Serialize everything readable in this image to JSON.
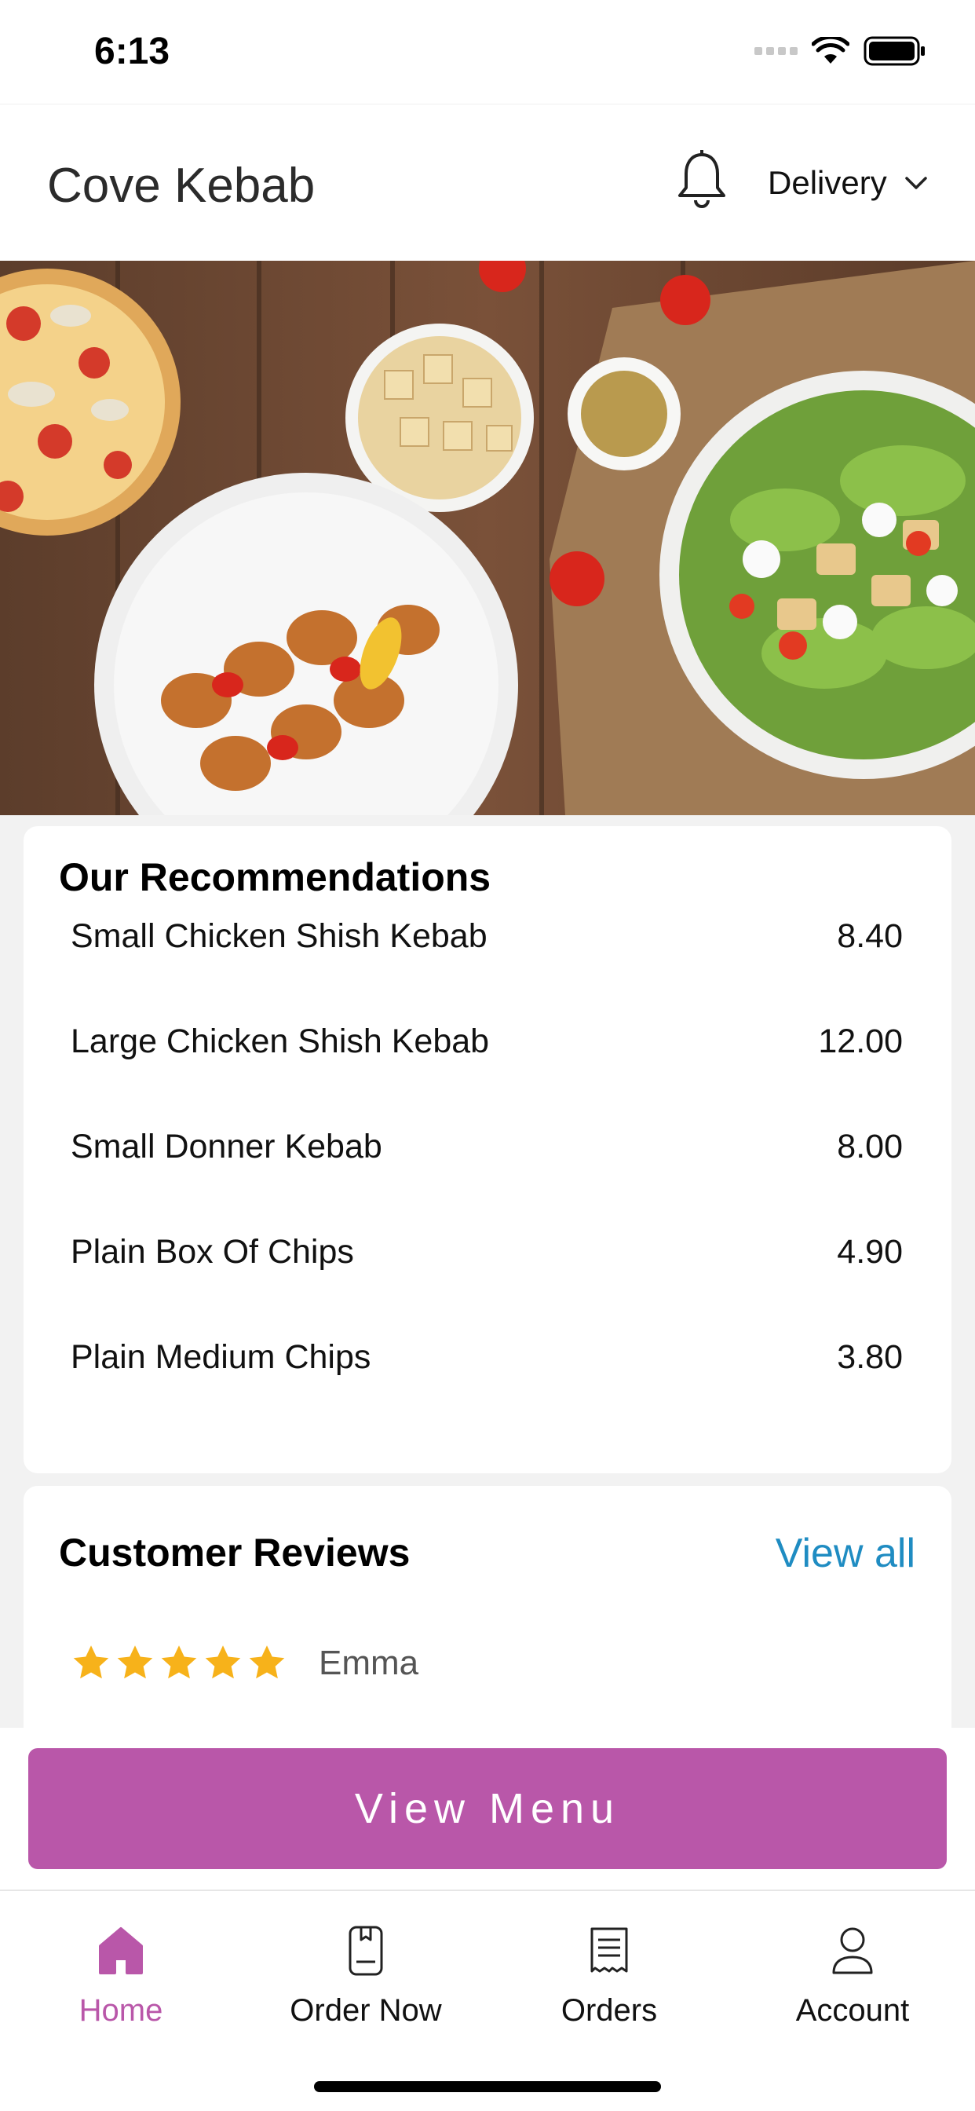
{
  "status": {
    "time": "6:13"
  },
  "header": {
    "title": "Cove Kebab",
    "mode": "Delivery"
  },
  "recommendations": {
    "title": "Our Recommendations",
    "items": [
      {
        "name": "Small Chicken Shish Kebab",
        "price": "8.40"
      },
      {
        "name": "Large Chicken Shish Kebab",
        "price": "12.00"
      },
      {
        "name": "Small Donner Kebab",
        "price": "8.00"
      },
      {
        "name": "Plain Box Of Chips",
        "price": "4.90"
      },
      {
        "name": "Plain Medium Chips",
        "price": "3.80"
      }
    ]
  },
  "reviews": {
    "title": "Customer Reviews",
    "view_all": "View all",
    "items": [
      {
        "rating": 5,
        "name": "Emma"
      }
    ]
  },
  "cta": {
    "label": "View Menu"
  },
  "tabs": [
    {
      "label": "Home",
      "icon": "home-icon",
      "active": true
    },
    {
      "label": "Order Now",
      "icon": "order-now-icon",
      "active": false
    },
    {
      "label": "Orders",
      "icon": "receipt-icon",
      "active": false
    },
    {
      "label": "Account",
      "icon": "account-icon",
      "active": false
    }
  ],
  "colors": {
    "accent": "#b957a9",
    "link": "#1f8cc2",
    "star": "#f7b21a"
  }
}
